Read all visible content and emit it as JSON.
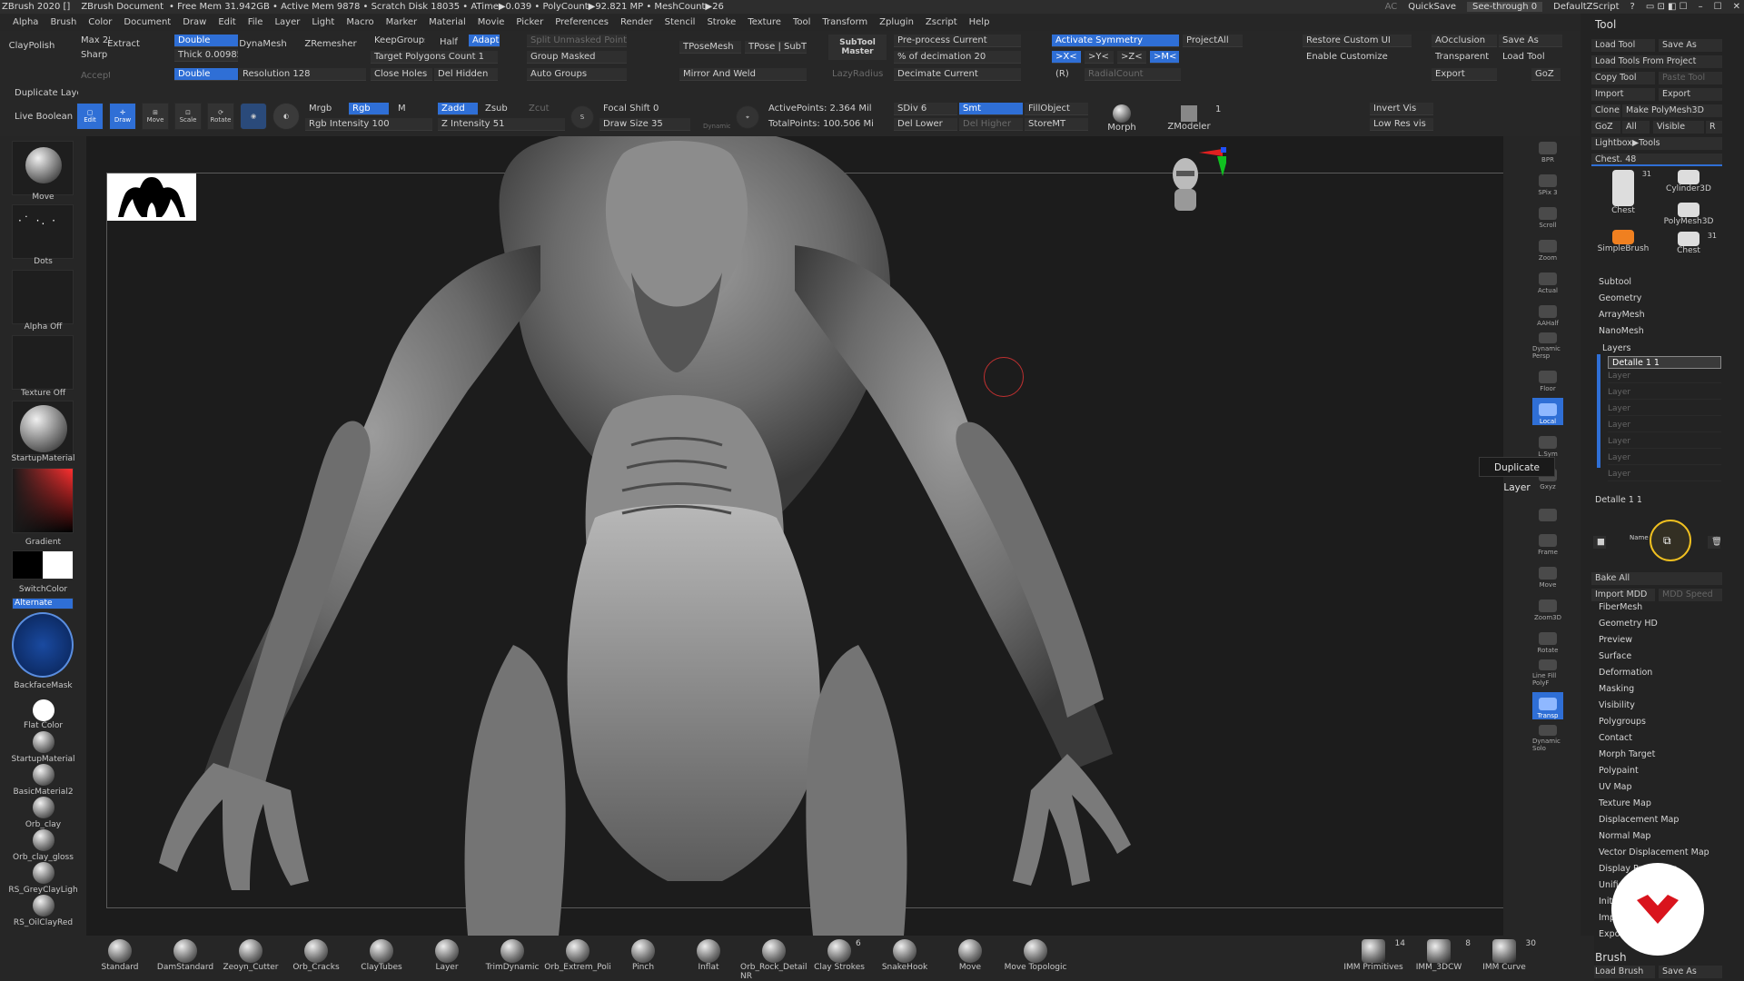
{
  "titlebar": {
    "app": "ZBrush 2020 []",
    "document": "ZBrush Document",
    "stats": "• Free Mem 31.942GB • Active Mem 9878 • Scratch Disk 18035 • ATime▶0.039 • PolyCount▶92.821 MP • MeshCount▶26",
    "ac": "AC",
    "quicksave": "QuickSave",
    "see_through": "See-through  0",
    "default_zscript": "DefaultZScript"
  },
  "menu": [
    "Alpha",
    "Brush",
    "Color",
    "Document",
    "Draw",
    "Edit",
    "File",
    "Layer",
    "Light",
    "Macro",
    "Marker",
    "Material",
    "Movie",
    "Picker",
    "Preferences",
    "Render",
    "Stencil",
    "Stroke",
    "Texture",
    "Tool",
    "Transform",
    "Zplugin",
    "Zscript",
    "Help"
  ],
  "toolbar": {
    "claypolish": "ClayPolish",
    "max": "Max 25",
    "sharp": "Sharp",
    "extract": "Extract",
    "double1": "Double",
    "thick": "Thick 0.00985",
    "double2": "Double",
    "accept": "Accept",
    "dynamesh": "DynaMesh",
    "zremesher": "ZRemesher",
    "resolution": "Resolution 128",
    "keepgroups": "KeepGroups",
    "half": "Half",
    "adapt": "Adapt",
    "target_polys": "Target Polygons Count 1",
    "close_holes": "Close Holes",
    "del_hidden": "Del Hidden",
    "split_unmasked": "Split Unmasked Points",
    "group_masked": "Group Masked",
    "auto_groups": "Auto Groups",
    "tposemesh": "TPoseMesh",
    "tpose_subt": "TPose | SubT",
    "mirror_weld": "Mirror And Weld",
    "subtool_master": "SubTool Master",
    "lazyradius": "LazyRadius",
    "preprocess": "Pre-process Current",
    "decimation": "% of decimation 20",
    "decimate_current": "Decimate Current",
    "activate_symmetry": "Activate Symmetry",
    "projectall": "ProjectAll",
    "sym_x": ">X<",
    "sym_y": ">Y<",
    "sym_z": ">Z<",
    "sym_m": ">M<",
    "sym_r": "(R)",
    "radialcount": "RadialCount",
    "restore_ui": "Restore Custom UI",
    "enable_customize": "Enable Customize",
    "aocclusion": "AOcclusion",
    "transparent": "Transparent",
    "export": "Export",
    "save_as": "Save As",
    "load_tool": "Load Tool",
    "goz": "GoZ",
    "duplicate_layer": "Duplicate Layer",
    "live_boolean": "Live Boolean",
    "edit": "Edit",
    "draw": "Draw",
    "move": "Move",
    "scale": "Scale",
    "rotate": "Rotate",
    "mrgb": "Mrgb",
    "rgb": "Rgb",
    "m": "M",
    "zadd": "Zadd",
    "zsub": "Zsub",
    "zcut": "Zcut",
    "rgb_intensity": "Rgb Intensity 100",
    "z_intensity": "Z Intensity 51",
    "focal_shift": "Focal Shift 0",
    "draw_size": "Draw Size 35",
    "dynamic": "Dynamic",
    "active_points": "ActivePoints: 2.364 Mil",
    "total_points": "TotalPoints: 100.506 Mil",
    "sdiv": "SDiv 6",
    "smt": "Smt",
    "del_lower": "Del Lower",
    "del_higher": "Del Higher",
    "fillobject": "FillObject",
    "storemt": "StoreMT",
    "morph": "Morph",
    "zmodeler": "ZModeler",
    "zmodeler_count": "1",
    "invert_vis": "Invert Vis",
    "low_res_vis": "Low Res vis"
  },
  "left": {
    "brush": "Move",
    "stroke": "Dots",
    "alpha": "Alpha Off",
    "texture": "Texture Off",
    "material": "StartupMaterial",
    "gradient": "Gradient",
    "switchcolor": "SwitchColor",
    "alternate": "Alternate",
    "backfacemask": "BackfaceMask",
    "flat_color": "Flat Color",
    "materials": [
      "StartupMaterial",
      "BasicMaterial2",
      "Orb_clay",
      "Orb_clay_gloss",
      "RS_GreyClayLigh",
      "RS_OilClayRed"
    ]
  },
  "rightshelf": [
    "BPR",
    "SPix 3",
    "Scroll",
    "Zoom",
    "Actual",
    "AAHalf",
    "Dynamic Persp",
    "Floor",
    "Local",
    "L.Sym",
    "Gxyz",
    "",
    "Frame",
    "Move",
    "Zoom3D",
    "Rotate",
    "Line Fill PolyF",
    "Transp",
    "Dynamic Solo"
  ],
  "tool": {
    "title": "Tool",
    "load_tool": "Load Tool",
    "save_as": "Save As",
    "load_from_project": "Load Tools From Project",
    "copy_tool": "Copy Tool",
    "paste_tool": "Paste Tool",
    "import": "Import",
    "export": "Export",
    "clone": "Clone",
    "make_polymesh": "Make PolyMesh3D",
    "goz": "GoZ",
    "all": "All",
    "visible": "Visible",
    "r": "R",
    "lightbox_tools": "Lightbox▶Tools",
    "chest_slider": "Chest. 48",
    "thumbs": [
      {
        "label": "Chest",
        "count": "31"
      },
      {
        "label": "Cylinder3D",
        "count": ""
      },
      {
        "label": "SimpleBrush",
        "count": ""
      },
      {
        "label": "PolyMesh3D",
        "count": ""
      },
      {
        "label": "Chest",
        "count": "31"
      }
    ],
    "sections1": [
      "Subtool",
      "Geometry",
      "ArrayMesh",
      "NanoMesh"
    ],
    "layers_title": "Layers",
    "active_layer": "Detalle 1 1",
    "layer_rows": [
      "Layer",
      "Layer",
      "Layer",
      "Layer",
      "Layer",
      "Layer",
      "Layer"
    ],
    "current_layer": "Detalle 1 1",
    "name_btn": "Name",
    "bake_all": "Bake All",
    "import_mdd": "Import MDD",
    "mdd_speed": "MDD Speed",
    "sections2": [
      "FiberMesh",
      "Geometry HD",
      "Preview",
      "Surface",
      "Deformation",
      "Masking",
      "Visibility",
      "Polygroups",
      "Contact",
      "Morph Target",
      "Polypaint",
      "UV Map",
      "Texture Map",
      "Displacement Map",
      "Normal Map",
      "Vector Displacement Map",
      "Display Properties",
      "Unified Skin",
      "Initialize",
      "Import",
      "Export"
    ],
    "brush_title": "Brush",
    "load_brush": "Load Brush",
    "brush_save_as": "Save As"
  },
  "tooltip": "Duplicate Layer",
  "bottom_brushes": [
    "Standard",
    "DamStandard",
    "Zeoyn_Cutter",
    "Orb_Cracks",
    "ClayTubes",
    "Layer",
    "TrimDynamic",
    "Orb_Extrem_Poli",
    "Pinch",
    "Inflat",
    "Orb_Rock_Detail NR",
    "Clay Strokes",
    "SnakeHook",
    "Move",
    "Move Topologic"
  ],
  "bottom_right": [
    {
      "label": "IMM Primitives",
      "count": "14"
    },
    {
      "label": "IMM_3DCW",
      "count": "8"
    },
    {
      "label": "IMM Curve",
      "count": "30"
    }
  ],
  "clay_strokes_count": "6",
  "colors": {
    "accent": "#2f6fd6",
    "panel": "#262626",
    "viewport": "#1c1c1c",
    "logo": "#d9141d"
  }
}
